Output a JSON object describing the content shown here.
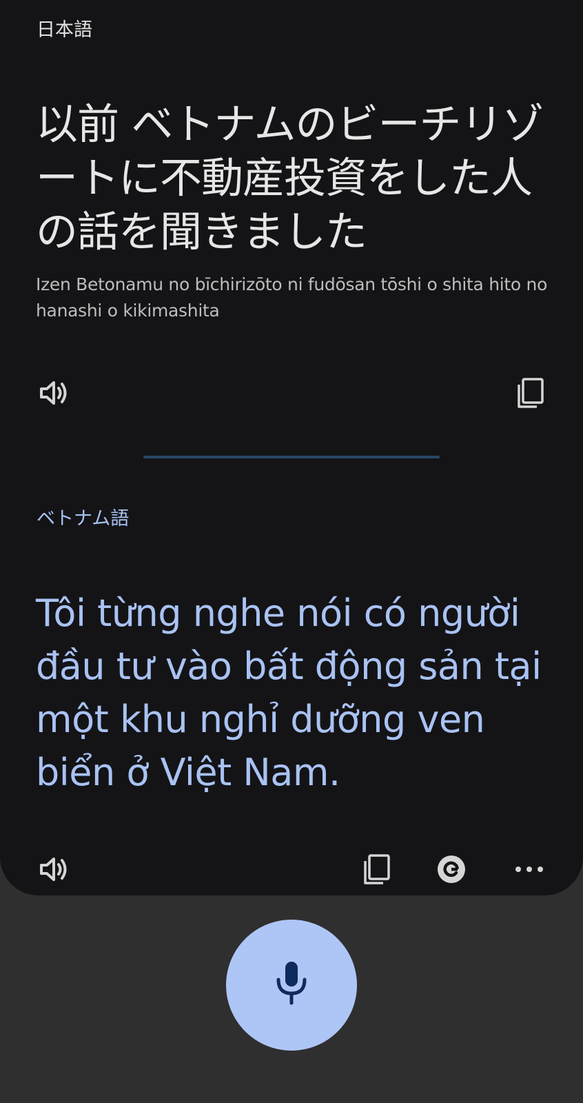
{
  "source": {
    "language": "日本語",
    "text": "以前 ベトナムのビーチリゾートに不動産投資をした人の話を聞きました",
    "romanization": "Izen Betonamu no bīchirizōto ni fudōsan tōshi o shita hito no hanashi o kikimashita",
    "icons": [
      "speaker-icon",
      "copy-icon"
    ]
  },
  "target": {
    "language": "ベトナム語",
    "text": "Tôi từng nghe nói có người đầu tư vào bất động sản tại một khu nghỉ dưỡng ven biển ở Việt Nam.",
    "icons": [
      "speaker-icon",
      "copy-icon",
      "google-icon",
      "more-icon"
    ]
  },
  "mic": {
    "icon": "mic-icon"
  },
  "colors": {
    "background": "#2f2f30",
    "card": "#141417",
    "source_text": "#e6e6e6",
    "accent": "#a9c2f2",
    "divider": "#274867",
    "mic_button": "#aec6f6",
    "mic_icon": "#0f2a5c"
  }
}
